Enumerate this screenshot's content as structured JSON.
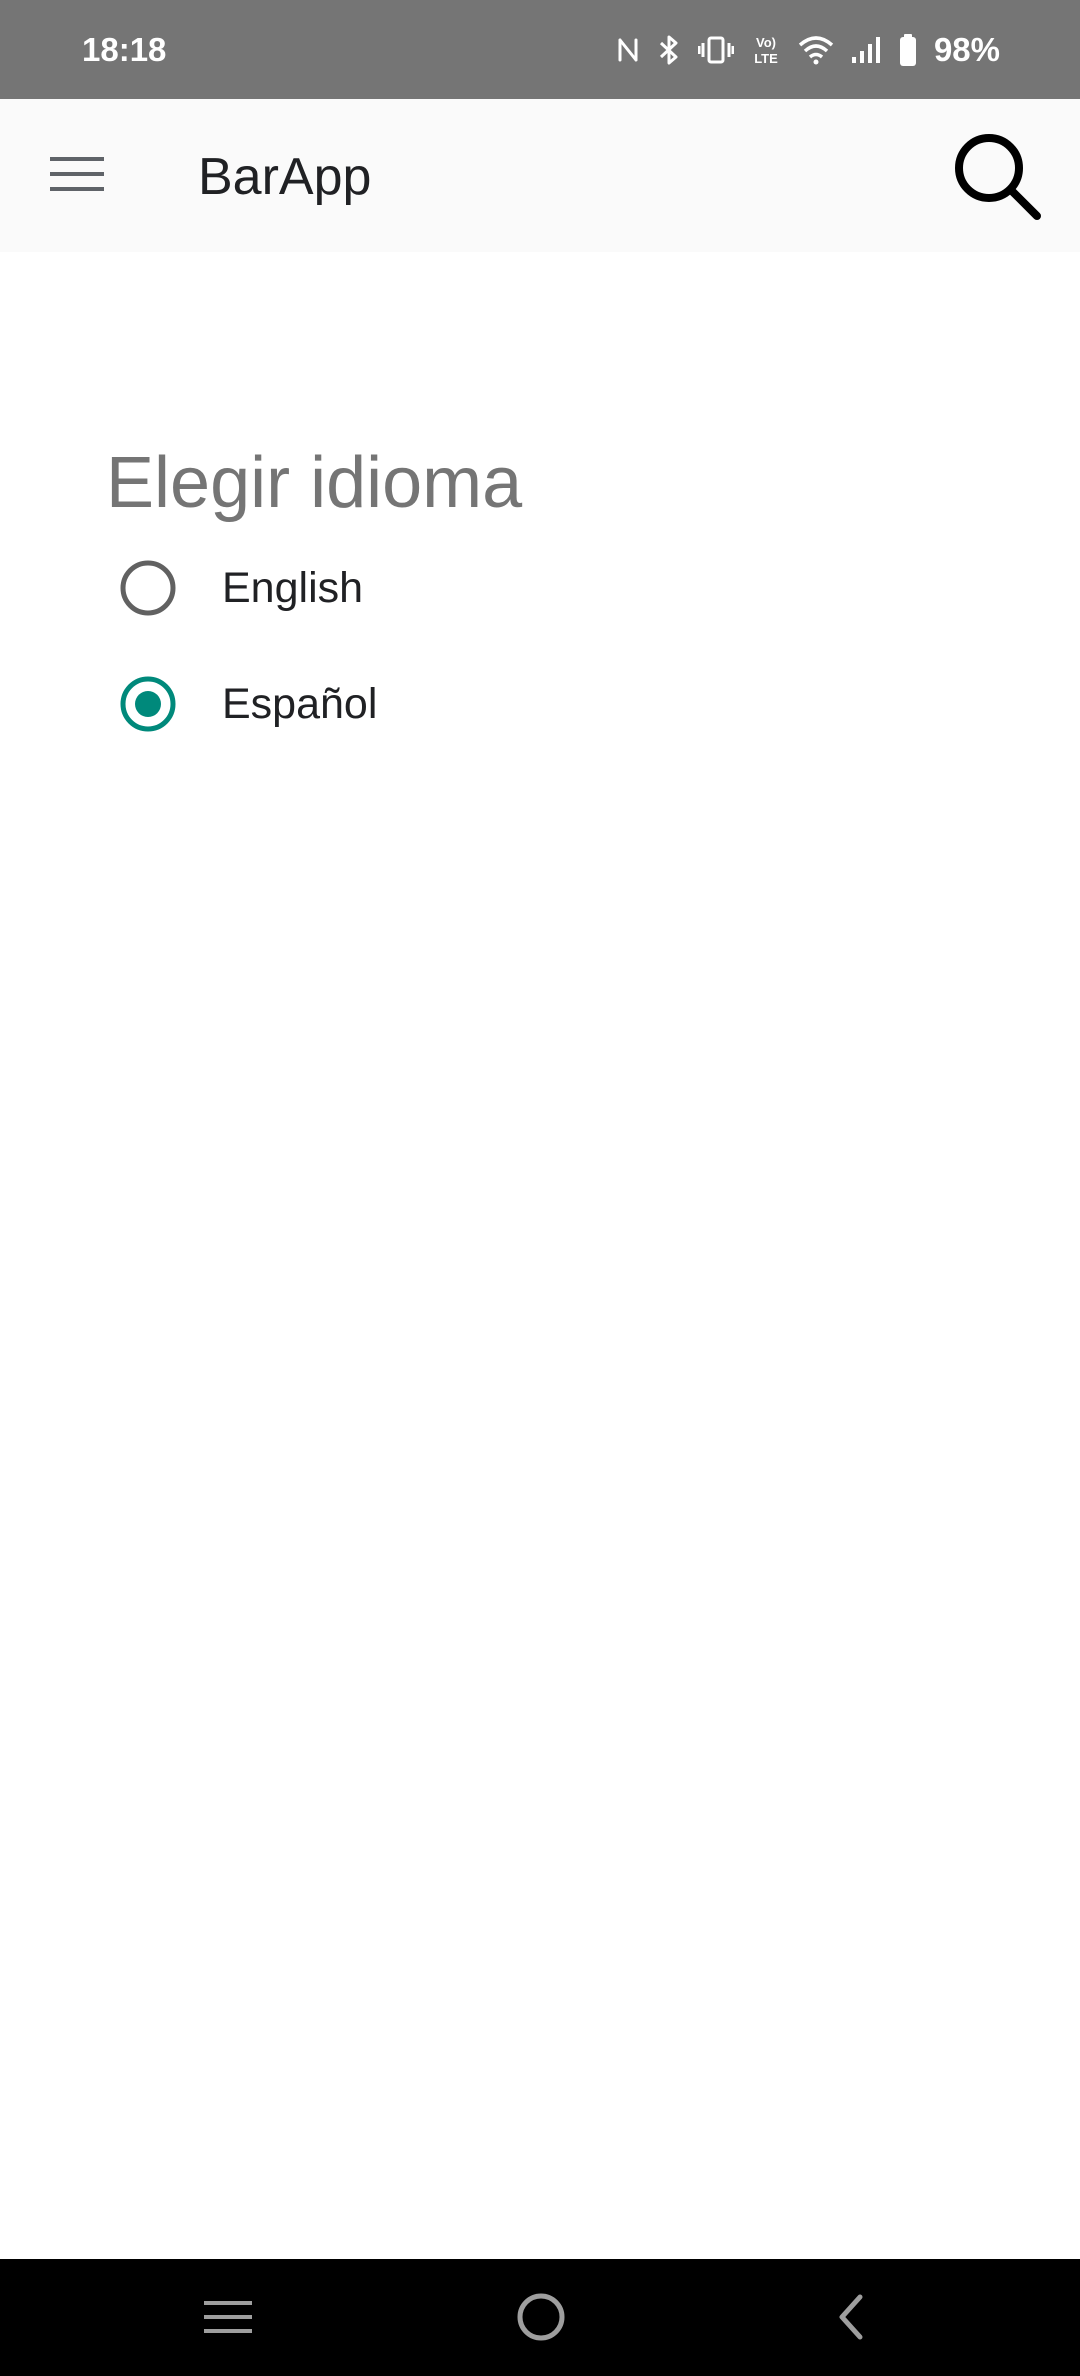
{
  "status_bar": {
    "time": "18:18",
    "battery_percent": "98%",
    "icons": [
      "nfc-icon",
      "bluetooth-icon",
      "vibrate-icon",
      "volte-icon",
      "wifi-icon",
      "signal-icon",
      "battery-icon"
    ]
  },
  "app_bar": {
    "title": "BarApp",
    "menu_icon": "hamburger-menu-icon",
    "search_icon": "search-icon"
  },
  "language_section": {
    "title": "Elegir idioma",
    "options": [
      {
        "label": "English",
        "selected": false
      },
      {
        "label": "Español",
        "selected": true
      }
    ]
  },
  "colors": {
    "accent": "#00897B",
    "status_bar": "#757575",
    "app_bar": "#FAFAFA",
    "nav_bar": "#000000",
    "section_title": "#757575"
  },
  "nav_bar": {
    "icons": [
      "recents-icon",
      "home-icon",
      "back-icon"
    ]
  }
}
